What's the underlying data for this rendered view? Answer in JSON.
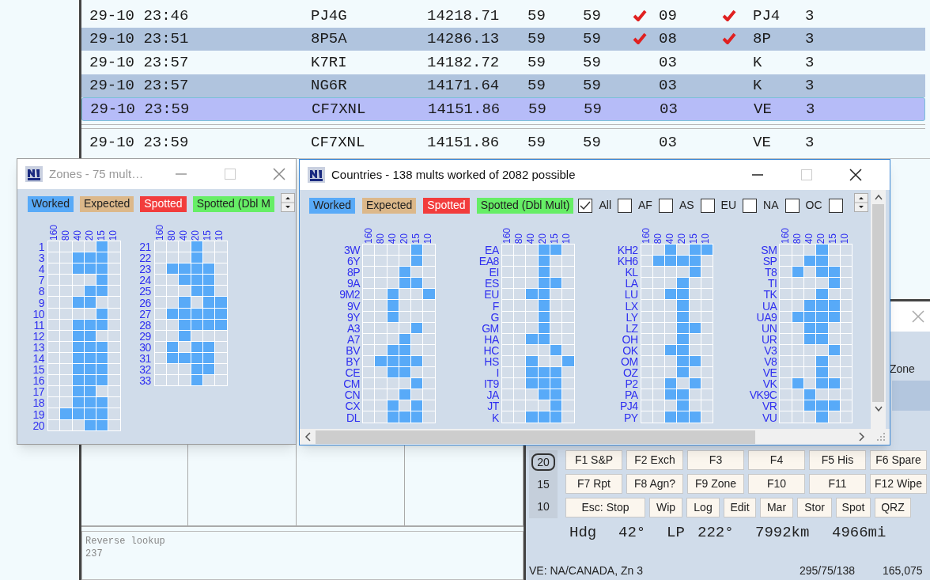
{
  "log": {
    "rows": [
      {
        "time": "29-10 23:46",
        "call": "PJ4G",
        "freq": "14218.71",
        "snt": "59",
        "rcv": "59",
        "new_zone": true,
        "zone": "09",
        "new_prefix": true,
        "prefix": "PJ4",
        "points": "3",
        "selected": false
      },
      {
        "time": "29-10 23:51",
        "call": "8P5A",
        "freq": "14286.13",
        "snt": "59",
        "rcv": "59",
        "new_zone": true,
        "zone": "08",
        "new_prefix": true,
        "prefix": "8P",
        "points": "3",
        "selected": false
      },
      {
        "time": "29-10 23:57",
        "call": "K7RI",
        "freq": "14182.72",
        "snt": "59",
        "rcv": "59",
        "new_zone": false,
        "zone": "03",
        "new_prefix": false,
        "prefix": "K",
        "points": "3",
        "selected": false
      },
      {
        "time": "29-10 23:57",
        "call": "NG6R",
        "freq": "14171.64",
        "snt": "59",
        "rcv": "59",
        "new_zone": false,
        "zone": "03",
        "new_prefix": false,
        "prefix": "K",
        "points": "3",
        "selected": false
      },
      {
        "time": "29-10 23:59",
        "call": "CF7XNL",
        "freq": "14151.86",
        "snt": "59",
        "rcv": "59",
        "new_zone": false,
        "zone": "03",
        "new_prefix": false,
        "prefix": "VE",
        "points": "3",
        "selected": true
      }
    ],
    "entry": {
      "time": "29-10 23:59",
      "call": "CF7XNL",
      "freq": "14151.86",
      "snt": "59",
      "rcv": "59",
      "zone": "03",
      "prefix": "VE",
      "points": "3"
    }
  },
  "reverse_lookup": {
    "label": "Reverse lookup",
    "value": "237"
  },
  "zones_window": {
    "title": "Zones - 75 mult…",
    "legend": [
      {
        "label": "Worked",
        "color": "#58aaf8"
      },
      {
        "label": "Expected",
        "color": "#dcb88a"
      },
      {
        "label": "Spotted",
        "color": "#f23c3c"
      },
      {
        "label": "Spotted (Dbl M",
        "color": "#66ee66"
      }
    ],
    "columns": [
      {
        "bands": [
          "160",
          "80",
          "40",
          "20",
          "15",
          "10"
        ],
        "rows": [
          {
            "label": "1",
            "worked": [
              false,
              false,
              false,
              false,
              true,
              false
            ]
          },
          {
            "label": "3",
            "worked": [
              false,
              false,
              true,
              true,
              true,
              false
            ]
          },
          {
            "label": "4",
            "worked": [
              false,
              false,
              true,
              true,
              true,
              false
            ]
          },
          {
            "label": "7",
            "worked": [
              false,
              false,
              false,
              false,
              true,
              false
            ]
          },
          {
            "label": "8",
            "worked": [
              false,
              false,
              false,
              true,
              true,
              false
            ]
          },
          {
            "label": "9",
            "worked": [
              false,
              false,
              true,
              true,
              false,
              false
            ]
          },
          {
            "label": "10",
            "worked": [
              false,
              false,
              false,
              false,
              true,
              false
            ]
          },
          {
            "label": "11",
            "worked": [
              false,
              false,
              true,
              true,
              true,
              false
            ]
          },
          {
            "label": "12",
            "worked": [
              false,
              false,
              true,
              true,
              false,
              false
            ]
          },
          {
            "label": "13",
            "worked": [
              false,
              false,
              true,
              true,
              true,
              false
            ]
          },
          {
            "label": "14",
            "worked": [
              false,
              false,
              true,
              true,
              true,
              false
            ]
          },
          {
            "label": "15",
            "worked": [
              false,
              false,
              true,
              true,
              true,
              false
            ]
          },
          {
            "label": "16",
            "worked": [
              false,
              false,
              true,
              true,
              true,
              false
            ]
          },
          {
            "label": "17",
            "worked": [
              false,
              false,
              true,
              true,
              false,
              false
            ]
          },
          {
            "label": "18",
            "worked": [
              false,
              false,
              true,
              true,
              true,
              false
            ]
          },
          {
            "label": "19",
            "worked": [
              false,
              true,
              true,
              true,
              true,
              false
            ]
          },
          {
            "label": "20",
            "worked": [
              false,
              false,
              false,
              true,
              true,
              false
            ]
          }
        ]
      },
      {
        "bands": [
          "160",
          "80",
          "40",
          "20",
          "15",
          "10"
        ],
        "rows": [
          {
            "label": "21",
            "worked": [
              false,
              false,
              false,
              true,
              false,
              false
            ]
          },
          {
            "label": "22",
            "worked": [
              false,
              false,
              false,
              true,
              false,
              false
            ]
          },
          {
            "label": "23",
            "worked": [
              false,
              true,
              true,
              true,
              true,
              false
            ]
          },
          {
            "label": "24",
            "worked": [
              false,
              false,
              true,
              true,
              true,
              false
            ]
          },
          {
            "label": "25",
            "worked": [
              false,
              false,
              false,
              true,
              true,
              false
            ]
          },
          {
            "label": "26",
            "worked": [
              false,
              false,
              true,
              false,
              true,
              true
            ]
          },
          {
            "label": "27",
            "worked": [
              false,
              true,
              true,
              true,
              true,
              true
            ]
          },
          {
            "label": "28",
            "worked": [
              false,
              false,
              true,
              true,
              true,
              true
            ]
          },
          {
            "label": "29",
            "worked": [
              false,
              false,
              true,
              false,
              false,
              false
            ]
          },
          {
            "label": "30",
            "worked": [
              false,
              true,
              false,
              true,
              true,
              false
            ]
          },
          {
            "label": "31",
            "worked": [
              false,
              true,
              true,
              true,
              true,
              false
            ]
          },
          {
            "label": "32",
            "worked": [
              false,
              false,
              false,
              true,
              true,
              false
            ]
          },
          {
            "label": "33",
            "worked": [
              false,
              false,
              false,
              true,
              false,
              false
            ]
          }
        ]
      }
    ]
  },
  "countries_window": {
    "title": "Countries - 138 mults worked of 2082 possible",
    "legend": [
      {
        "label": "Worked",
        "color": "#58aaf8"
      },
      {
        "label": "Expected",
        "color": "#dcb88a"
      },
      {
        "label": "Spotted",
        "color": "#f23c3c"
      },
      {
        "label": "Spotted (Dbl Mult)",
        "color": "#66ee66"
      }
    ],
    "filters": [
      {
        "label": "All",
        "checked": true
      },
      {
        "label": "AF",
        "checked": false
      },
      {
        "label": "AS",
        "checked": false
      },
      {
        "label": "EU",
        "checked": false
      },
      {
        "label": "NA",
        "checked": false
      },
      {
        "label": "OC",
        "checked": false
      },
      {
        "checked": false
      }
    ],
    "columns": [
      {
        "bands": [
          "160",
          "80",
          "40",
          "20",
          "15",
          "10"
        ],
        "rows": [
          {
            "label": "3W",
            "worked": [
              false,
              false,
              false,
              false,
              true,
              false
            ]
          },
          {
            "label": "6Y",
            "worked": [
              false,
              false,
              false,
              false,
              true,
              false
            ]
          },
          {
            "label": "8P",
            "worked": [
              false,
              false,
              false,
              true,
              false,
              false
            ]
          },
          {
            "label": "9A",
            "worked": [
              false,
              false,
              false,
              true,
              true,
              false
            ]
          },
          {
            "label": "9M2",
            "worked": [
              false,
              false,
              true,
              false,
              false,
              true
            ]
          },
          {
            "label": "9V",
            "worked": [
              false,
              false,
              true,
              false,
              false,
              false
            ]
          },
          {
            "label": "9Y",
            "worked": [
              false,
              false,
              true,
              false,
              false,
              false
            ]
          },
          {
            "label": "A3",
            "worked": [
              false,
              false,
              false,
              false,
              true,
              false
            ]
          },
          {
            "label": "A7",
            "worked": [
              false,
              false,
              false,
              true,
              false,
              false
            ]
          },
          {
            "label": "BV",
            "worked": [
              false,
              false,
              true,
              true,
              false,
              false
            ]
          },
          {
            "label": "BY",
            "worked": [
              false,
              true,
              true,
              true,
              true,
              false
            ]
          },
          {
            "label": "CE",
            "worked": [
              false,
              false,
              true,
              true,
              false,
              false
            ]
          },
          {
            "label": "CM",
            "worked": [
              false,
              false,
              false,
              false,
              true,
              false
            ]
          },
          {
            "label": "CN",
            "worked": [
              false,
              false,
              false,
              true,
              false,
              false
            ]
          },
          {
            "label": "CX",
            "worked": [
              false,
              false,
              true,
              false,
              true,
              false
            ]
          },
          {
            "label": "DL",
            "worked": [
              false,
              false,
              true,
              true,
              true,
              false
            ]
          }
        ]
      },
      {
        "bands": [
          "160",
          "80",
          "40",
          "20",
          "15",
          "10"
        ],
        "rows": [
          {
            "label": "EA",
            "worked": [
              false,
              false,
              false,
              true,
              true,
              false
            ]
          },
          {
            "label": "EA8",
            "worked": [
              false,
              false,
              false,
              true,
              false,
              false
            ]
          },
          {
            "label": "EI",
            "worked": [
              false,
              false,
              false,
              true,
              false,
              false
            ]
          },
          {
            "label": "ES",
            "worked": [
              false,
              false,
              false,
              true,
              true,
              false
            ]
          },
          {
            "label": "EU",
            "worked": [
              false,
              false,
              true,
              true,
              false,
              false
            ]
          },
          {
            "label": "F",
            "worked": [
              false,
              false,
              false,
              true,
              false,
              false
            ]
          },
          {
            "label": "G",
            "worked": [
              false,
              false,
              false,
              true,
              false,
              false
            ]
          },
          {
            "label": "GM",
            "worked": [
              false,
              false,
              false,
              true,
              false,
              false
            ]
          },
          {
            "label": "HA",
            "worked": [
              false,
              false,
              true,
              true,
              false,
              false
            ]
          },
          {
            "label": "HC",
            "worked": [
              false,
              false,
              false,
              false,
              true,
              false
            ]
          },
          {
            "label": "HS",
            "worked": [
              false,
              false,
              true,
              false,
              false,
              true
            ]
          },
          {
            "label": "I",
            "worked": [
              false,
              false,
              true,
              true,
              true,
              false
            ]
          },
          {
            "label": "IT9",
            "worked": [
              false,
              false,
              true,
              true,
              true,
              false
            ]
          },
          {
            "label": "JA",
            "worked": [
              false,
              false,
              false,
              true,
              true,
              false
            ]
          },
          {
            "label": "JT",
            "worked": [
              false,
              false,
              false,
              false,
              true,
              false
            ]
          },
          {
            "label": "K",
            "worked": [
              false,
              false,
              true,
              true,
              true,
              false
            ]
          }
        ]
      },
      {
        "bands": [
          "160",
          "80",
          "40",
          "20",
          "15",
          "10"
        ],
        "rows": [
          {
            "label": "KH2",
            "worked": [
              false,
              false,
              true,
              false,
              true,
              true
            ]
          },
          {
            "label": "KH6",
            "worked": [
              false,
              true,
              true,
              true,
              true,
              false
            ]
          },
          {
            "label": "KL",
            "worked": [
              false,
              false,
              false,
              false,
              true,
              false
            ]
          },
          {
            "label": "LA",
            "worked": [
              false,
              false,
              false,
              true,
              false,
              false
            ]
          },
          {
            "label": "LU",
            "worked": [
              false,
              false,
              true,
              true,
              false,
              false
            ]
          },
          {
            "label": "LX",
            "worked": [
              false,
              false,
              false,
              true,
              false,
              false
            ]
          },
          {
            "label": "LY",
            "worked": [
              false,
              false,
              false,
              true,
              false,
              false
            ]
          },
          {
            "label": "LZ",
            "worked": [
              false,
              false,
              false,
              true,
              true,
              false
            ]
          },
          {
            "label": "OH",
            "worked": [
              false,
              false,
              false,
              true,
              false,
              false
            ]
          },
          {
            "label": "OK",
            "worked": [
              false,
              false,
              true,
              true,
              false,
              false
            ]
          },
          {
            "label": "OM",
            "worked": [
              false,
              false,
              false,
              true,
              true,
              false
            ]
          },
          {
            "label": "OZ",
            "worked": [
              false,
              false,
              false,
              true,
              false,
              false
            ]
          },
          {
            "label": "P2",
            "worked": [
              false,
              false,
              true,
              false,
              true,
              false
            ]
          },
          {
            "label": "PA",
            "worked": [
              false,
              false,
              true,
              true,
              false,
              false
            ]
          },
          {
            "label": "PJ4",
            "worked": [
              false,
              false,
              false,
              true,
              false,
              false
            ]
          },
          {
            "label": "PY",
            "worked": [
              false,
              false,
              true,
              true,
              true,
              false
            ]
          }
        ]
      },
      {
        "bands": [
          "160",
          "80",
          "40",
          "20",
          "15",
          "10"
        ],
        "rows": [
          {
            "label": "SM",
            "worked": [
              false,
              false,
              false,
              true,
              false,
              false
            ]
          },
          {
            "label": "SP",
            "worked": [
              false,
              false,
              true,
              true,
              false,
              false
            ]
          },
          {
            "label": "T8",
            "worked": [
              false,
              true,
              false,
              true,
              true,
              false
            ]
          },
          {
            "label": "TI",
            "worked": [
              false,
              false,
              false,
              false,
              true,
              false
            ]
          },
          {
            "label": "TK",
            "worked": [
              false,
              false,
              false,
              true,
              false,
              false
            ]
          },
          {
            "label": "UA",
            "worked": [
              false,
              false,
              true,
              true,
              true,
              false
            ]
          },
          {
            "label": "UA9",
            "worked": [
              false,
              true,
              true,
              true,
              true,
              false
            ]
          },
          {
            "label": "UN",
            "worked": [
              false,
              false,
              true,
              true,
              false,
              false
            ]
          },
          {
            "label": "UR",
            "worked": [
              false,
              false,
              true,
              true,
              false,
              false
            ]
          },
          {
            "label": "V3",
            "worked": [
              false,
              false,
              false,
              false,
              true,
              false
            ]
          },
          {
            "label": "V8",
            "worked": [
              false,
              false,
              false,
              true,
              false,
              false
            ]
          },
          {
            "label": "VE",
            "worked": [
              false,
              false,
              false,
              true,
              false,
              false
            ]
          },
          {
            "label": "VK",
            "worked": [
              false,
              true,
              false,
              true,
              true,
              false
            ]
          },
          {
            "label": "VK9C",
            "worked": [
              false,
              false,
              true,
              false,
              false,
              false
            ]
          },
          {
            "label": "VR",
            "worked": [
              false,
              false,
              true,
              true,
              true,
              false
            ]
          },
          {
            "label": "VU",
            "worked": [
              false,
              false,
              false,
              true,
              false,
              false
            ]
          }
        ]
      }
    ]
  },
  "entry_window": {
    "field_label": "Zone",
    "bands": [
      {
        "label": "20",
        "selected": true
      },
      {
        "label": "15",
        "selected": false
      },
      {
        "label": "10",
        "selected": false
      }
    ],
    "function_keys": [
      [
        "F1 S&P",
        "F2 Exch",
        "F3",
        "F4",
        "F5 His",
        "F6 Spare"
      ],
      [
        "F7 Rpt",
        "F8 Agn?",
        "F9 Zone",
        "F10",
        "F11",
        "F12 Wipe"
      ],
      [
        "Esc: Stop",
        "Wip",
        "Log",
        "Edit",
        "Mar",
        "Stor",
        "Spot",
        "QRZ"
      ]
    ],
    "bearing": [
      "Hdg",
      "42°",
      "LP",
      "222°",
      "7992km",
      "4966mi"
    ],
    "status": {
      "location": "VE: NA/CANADA, Zn 3",
      "counts": "295/75/138",
      "score": "165,075"
    }
  }
}
